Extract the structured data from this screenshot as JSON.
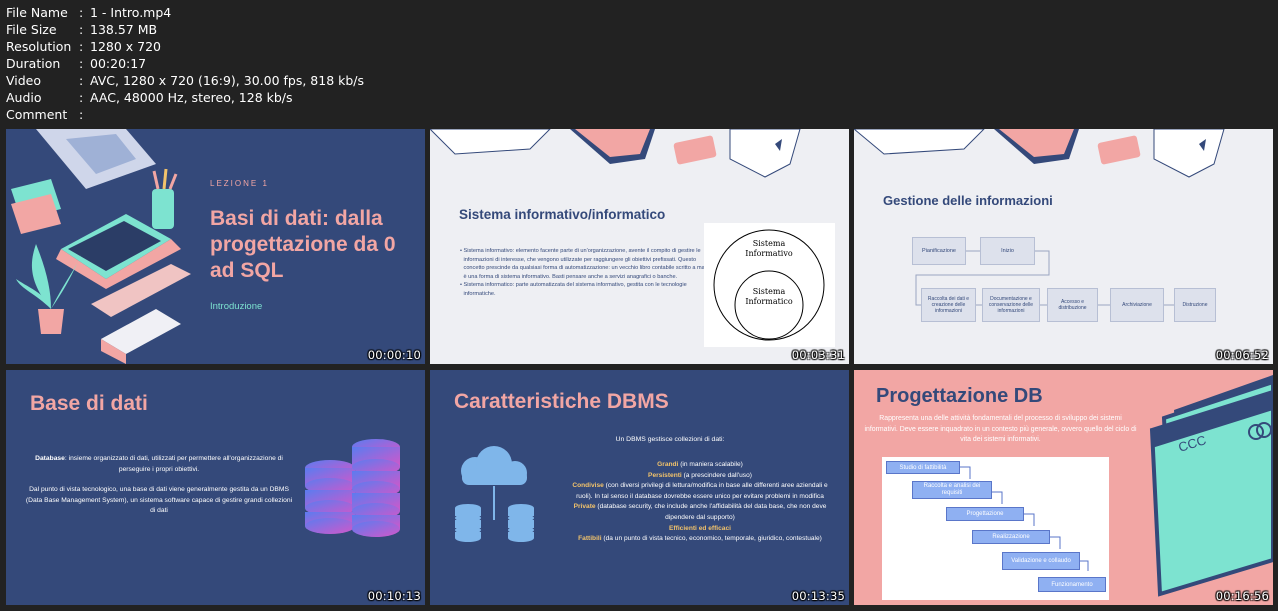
{
  "file_info": [
    {
      "key": "File Name",
      "value": "1 - Intro.mp4"
    },
    {
      "key": "File Size",
      "value": "138.57 MB"
    },
    {
      "key": "Resolution",
      "value": "1280 x 720"
    },
    {
      "key": "Duration",
      "value": "00:20:17"
    },
    {
      "key": "Video",
      "value": "AVC, 1280 x 720 (16:9), 30.00 fps, 818 kb/s"
    },
    {
      "key": "Audio",
      "value": "AAC, 48000 Hz, stereo, 128 kb/s"
    },
    {
      "key": "Comment",
      "value": ""
    }
  ],
  "colors": {
    "background": "#222222",
    "navy": "#34497a",
    "pink_text": "#f2a6a4",
    "slide_grey": "#eeeff3",
    "teal": "#7de3d0"
  },
  "thumbs": [
    {
      "timestamp": "00:00:10",
      "label": "LEZIONE 1",
      "title": "Basi di dati: dalla progettazione da 0 ad SQL",
      "subtitle": "Introduzione"
    },
    {
      "timestamp": "00:03:31",
      "title": "Sistema informativo/informatico",
      "bullets": [
        "Sistema informativo: elemento facente parte di un'organizzazione, avente il compito di gestire le informazioni di interesse, che vengono utilizzate per raggiungere gli obiettivi prefissati. Questo concetto prescinde da qualsiasi forma di automatizzazione: un vecchio libro contabile scritto a mano è una forma di sistema informativo. Basti pensare anche a servizi anagrafici o banche.",
        "Sistema informatico: parte automatizzata del sistema informativo, gestita con le tecnologie informatiche."
      ],
      "outer_label": "Sistema Informativo",
      "inner_label": "Sistema Informatico"
    },
    {
      "timestamp": "00:06:52",
      "title": "Gestione delle informazioni",
      "top_row": [
        "Pianificazione",
        "Inizio"
      ],
      "bottom_row": [
        "Raccolta dei dati e creazione delle informazioni",
        "Documentazione e conservazione delle informazioni",
        "Accesso e distribuzione",
        "Archiviazione",
        "Distruzione"
      ]
    },
    {
      "timestamp": "00:10:13",
      "title": "Base di dati",
      "p1_bold": "Database",
      "p1": ": insieme organizzato di dati, utilizzati per permettere all'organizzazione di perseguire i propri obiettivi.",
      "p2": "Dal punto di vista tecnologico, una base di dati viene generalmente gestita da un DBMS (Data Base Management System), un sistema software capace di gestire grandi collezioni di dati"
    },
    {
      "timestamp": "00:13:35",
      "title": "Caratteristiche DBMS",
      "intro": "Un DBMS gestisce collezioni di dati:",
      "items": [
        {
          "b": "Grandi",
          "t": " (in maniera scalabile)"
        },
        {
          "b": "Persistenti",
          "t": " (a prescindere dall'uso)"
        },
        {
          "b": "Condivise",
          "t": " (con diversi privilegi di lettura/modifica in base alle differenti aree aziendali e ruoli). In tal senso il database dovrebbe essere unico per evitare problemi in modifica"
        },
        {
          "b": "Private",
          "t": " (database security, che include anche l'affidabilità del data base, che non deve dipendere dal supporto)"
        },
        {
          "b": "Efficienti ed efficaci",
          "t": ""
        },
        {
          "b": "Fattibili",
          "t": " (da un punto di vista tecnico, economico, temporale, giuridico, contestuale)"
        }
      ]
    },
    {
      "timestamp": "00:16:56",
      "title": "Progettazione DB",
      "text": "Rappresenta una delle attività fondamentali del processo di sviluppo dei sistemi informativi. Deve essere inquadrato in un contesto più generale, ovvero quello del ciclo di vita dei sistemi informativi.",
      "card_text": "CCC",
      "steps": [
        "Studio di fattibilità",
        "Raccolta e analisi dei requisiti",
        "Progettazione",
        "Realizzazione",
        "Validazione e collaudo",
        "Funzionamento"
      ]
    }
  ]
}
